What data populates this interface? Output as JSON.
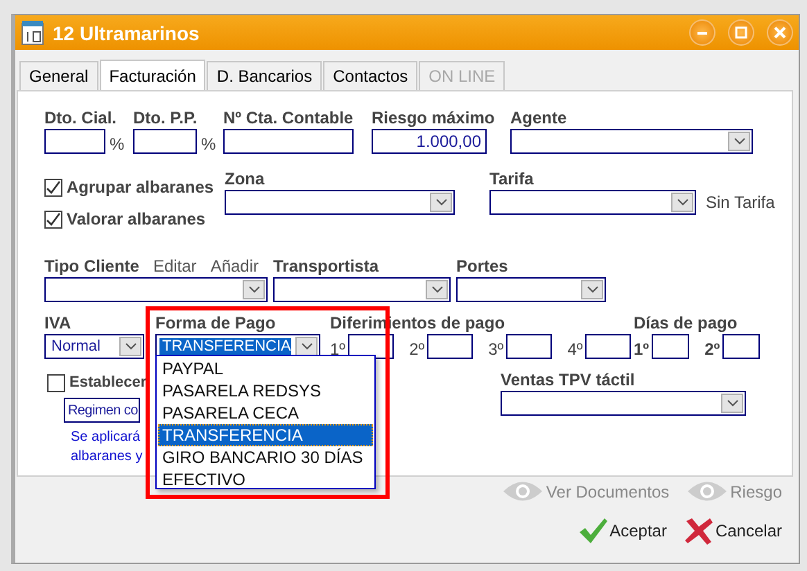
{
  "window": {
    "title": "12 Ultramarinos"
  },
  "tabs": [
    {
      "label": "General",
      "selected": false,
      "disabled": false
    },
    {
      "label": "Facturación",
      "selected": true,
      "disabled": false
    },
    {
      "label": "D. Bancarios",
      "selected": false,
      "disabled": false
    },
    {
      "label": "Contactos",
      "selected": false,
      "disabled": false
    },
    {
      "label": "ON LINE",
      "selected": false,
      "disabled": true
    }
  ],
  "descuentos": [
    {
      "label": "Dto. Cial.",
      "unit": "%"
    },
    {
      "label": "Dto. P.P.",
      "unit": "%"
    }
  ],
  "cuenta_contable": {
    "label": "Nº Cta. Contable"
  },
  "riesgo_maximo": {
    "label": "Riesgo máximo",
    "value": "1.000,00"
  },
  "agente": {
    "label": "Agente"
  },
  "checkboxes": [
    {
      "label": "Agrupar albaranes",
      "checked": true
    },
    {
      "label": "Valorar albaranes",
      "checked": true
    }
  ],
  "zona": {
    "label": "Zona"
  },
  "tarifa": {
    "label": "Tarifa",
    "note": "Sin Tarifa"
  },
  "tipo_cliente": {
    "label": "Tipo Cliente",
    "links": [
      "Editar",
      "Añadir"
    ]
  },
  "transportista": {
    "label": "Transportista"
  },
  "portes": {
    "label": "Portes"
  },
  "iva": {
    "label": "IVA",
    "value": "Normal"
  },
  "forma_pago": {
    "label": "Forma de Pago",
    "value": "TRANSFERENCIA",
    "expanded": true,
    "highlighted": true,
    "options": [
      {
        "label": "PAYPAL",
        "selected": false
      },
      {
        "label": "PASARELA REDSYS",
        "selected": false
      },
      {
        "label": "PASARELA CECA",
        "selected": false
      },
      {
        "label": "TRANSFERENCIA",
        "selected": true
      },
      {
        "label": "GIRO BANCARIO 30 DÍAS",
        "selected": false
      },
      {
        "label": "EFECTIVO",
        "selected": false
      }
    ]
  },
  "diferimientos": {
    "label": "Diferimientos de pago",
    "slots": [
      "1º",
      "2º",
      "3º",
      "4º"
    ]
  },
  "dias_pago": {
    "label": "Días de pago",
    "slots": [
      "1º",
      "2º"
    ]
  },
  "establecer": {
    "label": "Establecer",
    "checked": false
  },
  "regimen": {
    "value": "Regimen co"
  },
  "nota": [
    "Se aplicará",
    "albaranes y"
  ],
  "ventas_tpv": {
    "label": "Ventas TPV táctil"
  },
  "links": [
    {
      "label": "Ver Documentos"
    },
    {
      "label": "Riesgo"
    }
  ],
  "buttons": [
    {
      "label": "Aceptar",
      "kind": "accept"
    },
    {
      "label": "Cancelar",
      "kind": "cancel"
    }
  ]
}
